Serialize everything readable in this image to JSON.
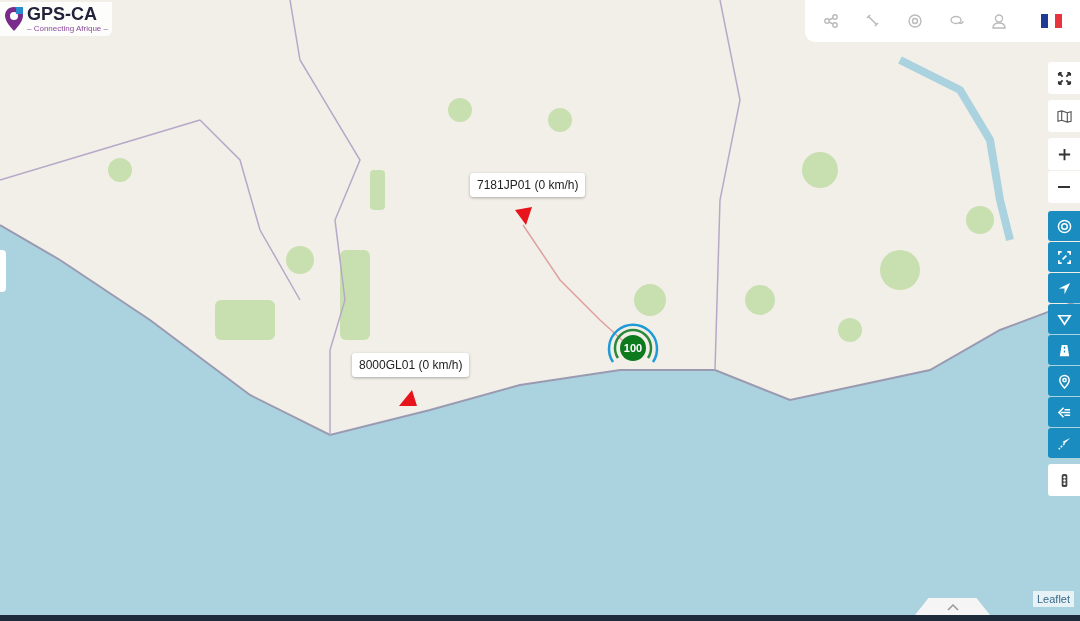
{
  "logo": {
    "name": "GPS-CA",
    "tagline": "– Connecting Afrique –"
  },
  "vehicles": [
    {
      "label": "7181JP01 (0 km/h)"
    },
    {
      "label": "8000GL01 (0 km/h)"
    }
  ],
  "cluster": {
    "count": "100"
  },
  "attribution": "Leaflet"
}
